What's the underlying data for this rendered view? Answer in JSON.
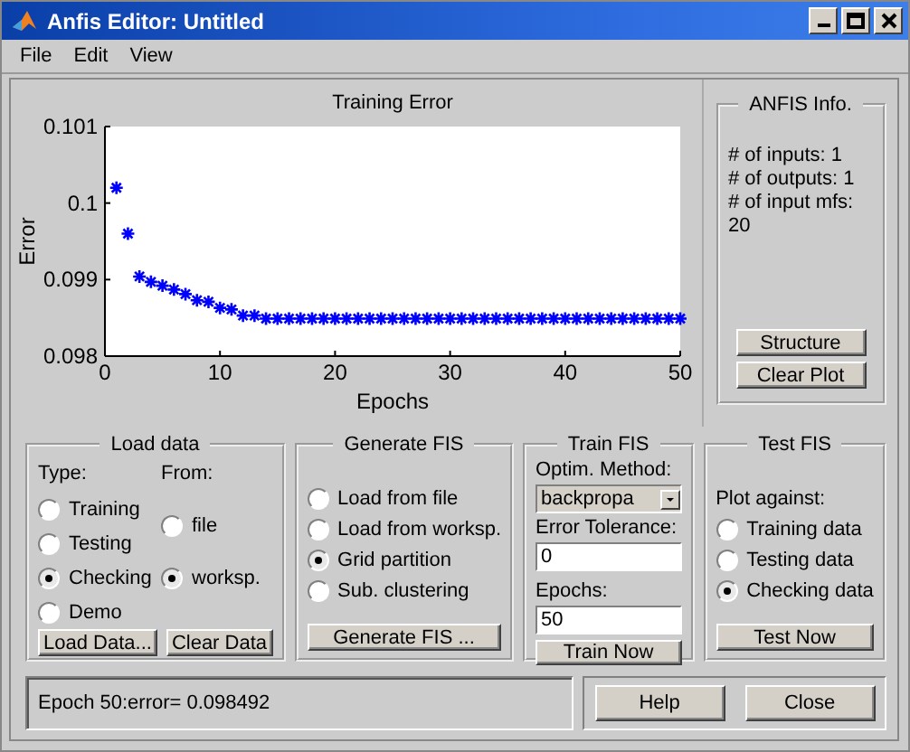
{
  "window": {
    "title": "Anfis Editor: Untitled"
  },
  "menu": [
    "File",
    "Edit",
    "View"
  ],
  "plot": {
    "chart_data": {
      "type": "scatter",
      "title": "Training Error",
      "xlabel": "Epochs",
      "ylabel": "Error",
      "x": [
        1,
        2,
        3,
        4,
        5,
        6,
        7,
        8,
        9,
        10,
        11,
        12,
        13,
        14,
        15,
        16,
        17,
        18,
        19,
        20,
        21,
        22,
        23,
        24,
        25,
        26,
        27,
        28,
        29,
        30,
        31,
        32,
        33,
        34,
        35,
        36,
        37,
        38,
        39,
        40,
        41,
        42,
        43,
        44,
        45,
        46,
        47,
        48,
        49,
        50
      ],
      "series": [
        {
          "color": "#0000ff",
          "values": [
            0.1002,
            0.0996,
            0.09904,
            0.09897,
            0.09892,
            0.09887,
            0.09881,
            0.09873,
            0.09871,
            0.09863,
            0.09861,
            0.09853,
            0.09853,
            0.09849,
            0.09849,
            0.09849,
            0.09849,
            0.09849,
            0.09849,
            0.09849,
            0.09849,
            0.09849,
            0.09849,
            0.09849,
            0.09849,
            0.09849,
            0.09849,
            0.09849,
            0.09849,
            0.09849,
            0.09849,
            0.09849,
            0.09849,
            0.09849,
            0.09849,
            0.09849,
            0.09849,
            0.09849,
            0.09849,
            0.09849,
            0.09849,
            0.09849,
            0.09849,
            0.09849,
            0.09849,
            0.09849,
            0.09849,
            0.09849,
            0.09849,
            0.09849
          ]
        }
      ],
      "xlim": [
        0,
        50
      ],
      "ylim": [
        0.098,
        0.101
      ],
      "xticks": [
        0,
        10,
        20,
        30,
        40,
        50
      ],
      "yticks": [
        0.098,
        0.099,
        0.1,
        0.101
      ]
    }
  },
  "anfis_info": {
    "title": "ANFIS Info.",
    "lines": [
      "# of inputs: 1",
      "# of outputs: 1",
      "# of input mfs:",
      "20"
    ],
    "buttons": [
      "Structure",
      "Clear Plot"
    ]
  },
  "load_data": {
    "title": "Load data",
    "type_label": "Type:",
    "from_label": "From:",
    "type_options": [
      {
        "label": "Training",
        "selected": false
      },
      {
        "label": "Testing",
        "selected": false
      },
      {
        "label": "Checking",
        "selected": true
      },
      {
        "label": "Demo",
        "selected": false
      }
    ],
    "from_options": [
      {
        "label": "file",
        "selected": false
      },
      {
        "label": "worksp.",
        "selected": true
      }
    ],
    "buttons": [
      "Load Data...",
      "Clear Data"
    ]
  },
  "generate_fis": {
    "title": "Generate FIS",
    "options": [
      {
        "label": "Load from file",
        "selected": false
      },
      {
        "label": "Load from worksp.",
        "selected": false
      },
      {
        "label": "Grid partition",
        "selected": true
      },
      {
        "label": "Sub. clustering",
        "selected": false
      }
    ],
    "button": "Generate FIS ..."
  },
  "train_fis": {
    "title": "Train FIS",
    "method_label": "Optim. Method:",
    "method": "backpropa",
    "tolerance_label": "Error Tolerance:",
    "tolerance": "0",
    "epochs_label": "Epochs:",
    "epochs": "50",
    "button": "Train Now"
  },
  "test_fis": {
    "title": "Test FIS",
    "plot_label": "Plot against:",
    "options": [
      {
        "label": "Training data",
        "selected": false
      },
      {
        "label": "Testing data",
        "selected": false
      },
      {
        "label": "Checking data",
        "selected": true
      }
    ],
    "button": "Test Now"
  },
  "status": "Epoch 50:error= 0.098492",
  "buttons": [
    "Help",
    "Close"
  ]
}
